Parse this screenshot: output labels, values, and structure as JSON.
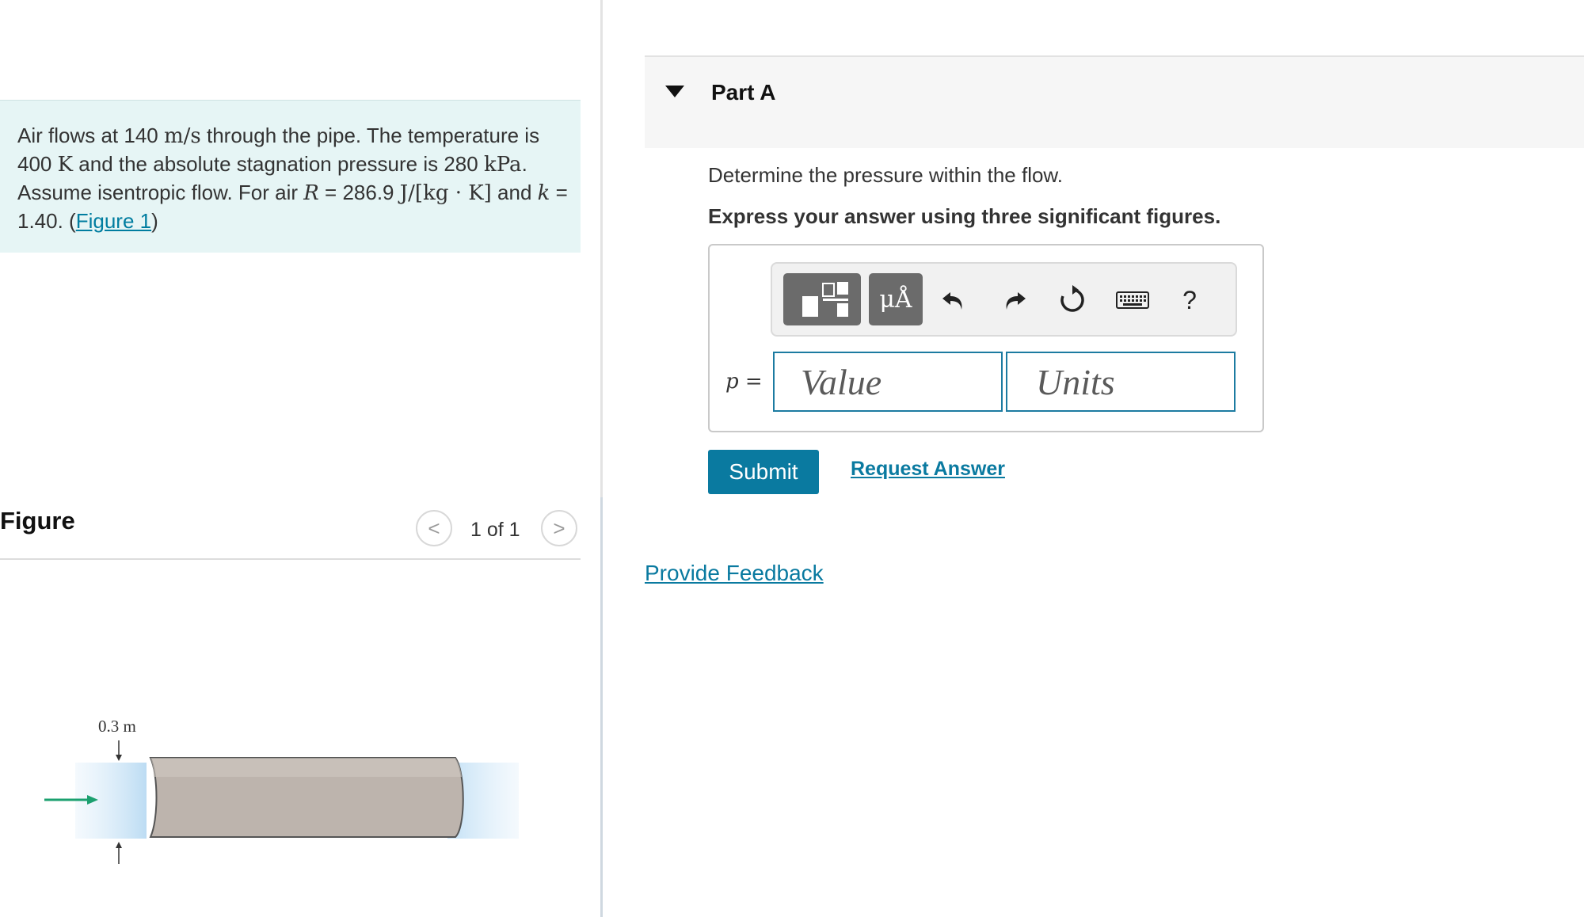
{
  "problem": {
    "text_1": "Air flows at 140 ",
    "math_velocity": "m/s",
    "text_2": " through the pipe. The temperature is 400 ",
    "math_temp_unit": "K",
    "text_3": " and the absolute stagnation pressure is 280 ",
    "math_pressure_unit": "kPa",
    "text_4": ". Assume isentropic flow. For air ",
    "math_R": "R",
    "text_5": " = 286.9 ",
    "math_R_unit": "J/[kg · K]",
    "text_6": " and ",
    "math_k": "k",
    "text_7": " = 1.40. (",
    "figure_link": "Figure 1",
    "text_8": ")"
  },
  "figure_panel": {
    "title": "Figure",
    "prev_label": "<",
    "counter": "1 of 1",
    "next_label": ">",
    "diameter_label": "0.3 m"
  },
  "part_a": {
    "title": "Part A",
    "question": "Determine the pressure within the flow.",
    "instruction": "Express your answer using three significant figures.",
    "variable_label": "p =",
    "value_placeholder": "Value",
    "units_placeholder": "Units",
    "units_tool_label": "μÅ",
    "help_label": "?",
    "submit_label": "Submit",
    "request_answer_label": "Request Answer"
  },
  "feedback_label": "Provide Feedback",
  "colors": {
    "accent": "#0a7aa0",
    "problem_bg": "#e6f5f5",
    "input_border": "#1c7ba1"
  }
}
